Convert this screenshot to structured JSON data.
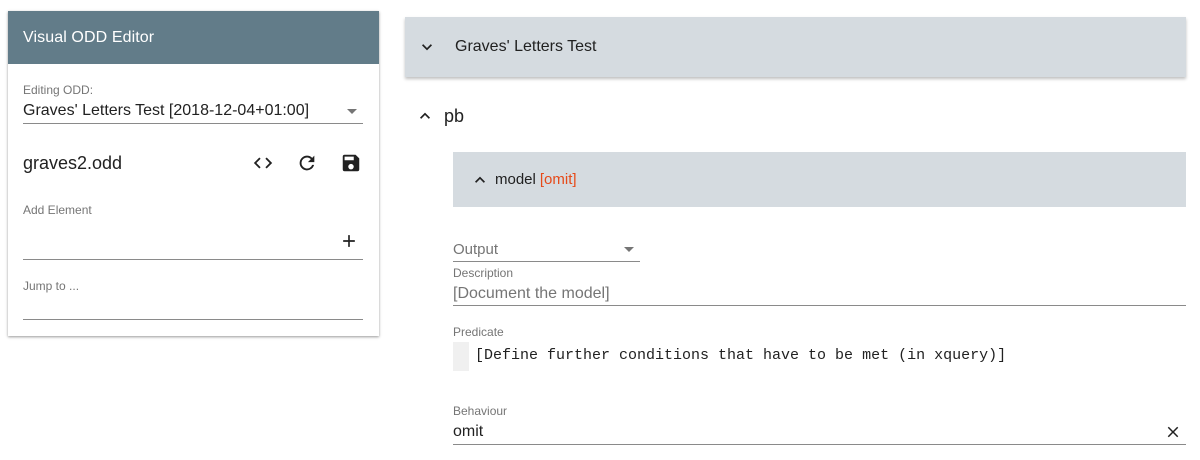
{
  "editor": {
    "title": "Visual ODD Editor",
    "editing_label": "Editing ODD:",
    "editing_value": "Graves' Letters Test [2018-12-04+01:00]",
    "odd_filename": "graves2.odd",
    "actions": [
      "code-icon",
      "refresh-icon",
      "save-icon"
    ],
    "add_element_label": "Add Element",
    "add_element_value": "",
    "jump_label": "Jump to ...",
    "jump_value": ""
  },
  "main": {
    "odd_title": "Graves' Letters Test",
    "element_name": "pb",
    "model": {
      "label": "model",
      "tag": "[omit]",
      "output_placeholder": "Output",
      "description_label": "Description",
      "description_value": "[Document the model]",
      "predicate_label": "Predicate",
      "predicate_value": "[Define further conditions that have to be met (in xquery)]",
      "behaviour_label": "Behaviour",
      "behaviour_value": "omit"
    }
  },
  "colors": {
    "header": "#627c89",
    "bar": "#d5dbe0",
    "omit": "#e64a19"
  }
}
